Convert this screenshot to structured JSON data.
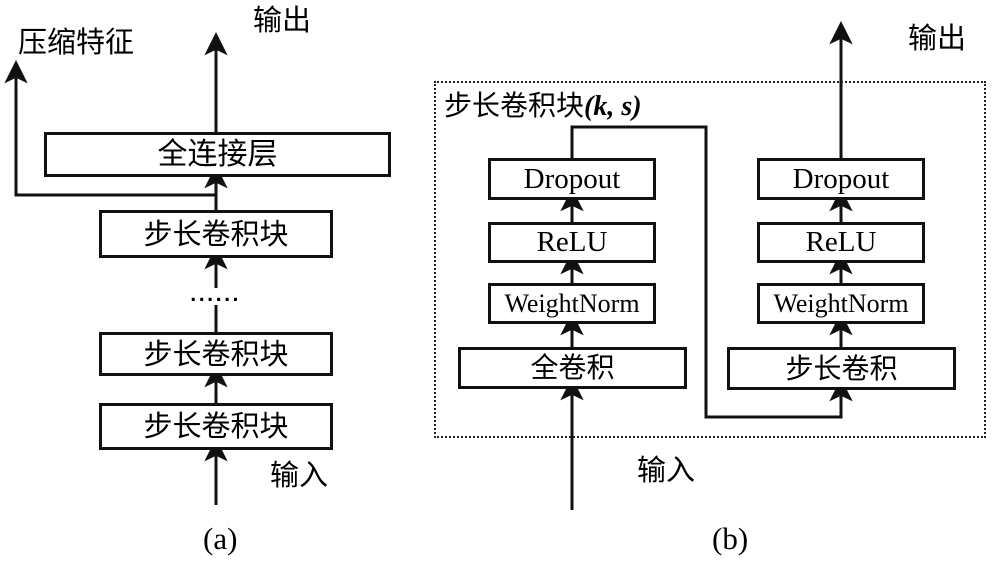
{
  "figure": {
    "caption_a": "(a)",
    "caption_b": "(b)"
  },
  "panel_a": {
    "top_label_left": "压缩特征",
    "top_label_right": "输出",
    "bottom_label": "输入",
    "blocks": [
      {
        "id": "fc",
        "label": "全连接层"
      },
      {
        "id": "strided-block-top",
        "label": "步长卷积块"
      },
      {
        "id": "strided-block-mid",
        "label": "步长卷积块"
      },
      {
        "id": "strided-block-bottom",
        "label": "步长卷积块"
      }
    ],
    "ellipsis": "......"
  },
  "panel_b": {
    "title_cn": "步长卷积块",
    "title_open_paren": "(",
    "title_param_k": "k",
    "title_comma": ", ",
    "title_param_s": "s",
    "title_close_paren": ")",
    "top_label": "输出",
    "bottom_label": "输入",
    "left_column": [
      {
        "id": "dropout-left",
        "label": "Dropout"
      },
      {
        "id": "relu-left",
        "label": "ReLU"
      },
      {
        "id": "weightnorm-left",
        "label": "WeightNorm"
      },
      {
        "id": "fullconv",
        "label": "全卷积"
      }
    ],
    "right_column": [
      {
        "id": "dropout-right",
        "label": "Dropout"
      },
      {
        "id": "relu-right",
        "label": "ReLU"
      },
      {
        "id": "weightnorm-right",
        "label": "WeightNorm"
      },
      {
        "id": "stridedconv",
        "label": "步长卷积"
      }
    ]
  },
  "colors": {
    "stroke": "#111111",
    "dotted_stroke": "#222222",
    "background": "#ffffff"
  }
}
